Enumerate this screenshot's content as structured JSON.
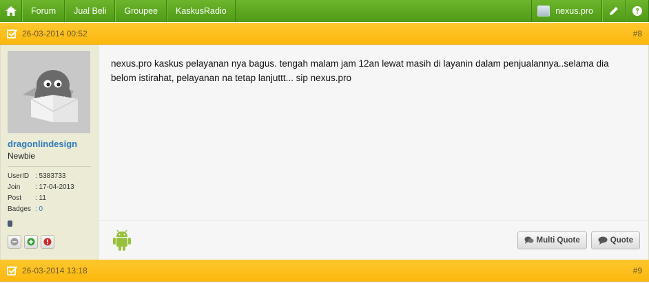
{
  "nav": {
    "items": [
      {
        "label": "Forum"
      },
      {
        "label": "Jual Beli"
      },
      {
        "label": "Groupee"
      },
      {
        "label": "KaskusRadio"
      }
    ],
    "user": "nexus.pro"
  },
  "post": {
    "date": "26-03-2014 00:52",
    "number": "#8",
    "author": {
      "username": "dragonlindesign",
      "rank": "Newbie",
      "info": [
        {
          "key": "UserID",
          "value": ": 5383733"
        },
        {
          "key": "Join",
          "value": ": 17-04-2013"
        },
        {
          "key": "Post",
          "value": ": 11"
        },
        {
          "key": "Badges",
          "value": ": 0"
        }
      ]
    },
    "body": "nexus.pro kaskus pelayanan nya bagus. tengah malam jam 12an lewat masih di layanin dalam penjualannya..selama dia belom istirahat, pelayanan na tetap lanjuttt... sip nexus.pro",
    "buttons": {
      "multi_quote": "Multi Quote",
      "quote": "Quote"
    }
  },
  "next_post": {
    "date": "26-03-2014 13:18",
    "number": "#9"
  },
  "colors": {
    "nav": "#5ca71f",
    "bar": "#fbbd1a",
    "link": "#2f7ab9",
    "sidebar": "#ebebd6"
  }
}
